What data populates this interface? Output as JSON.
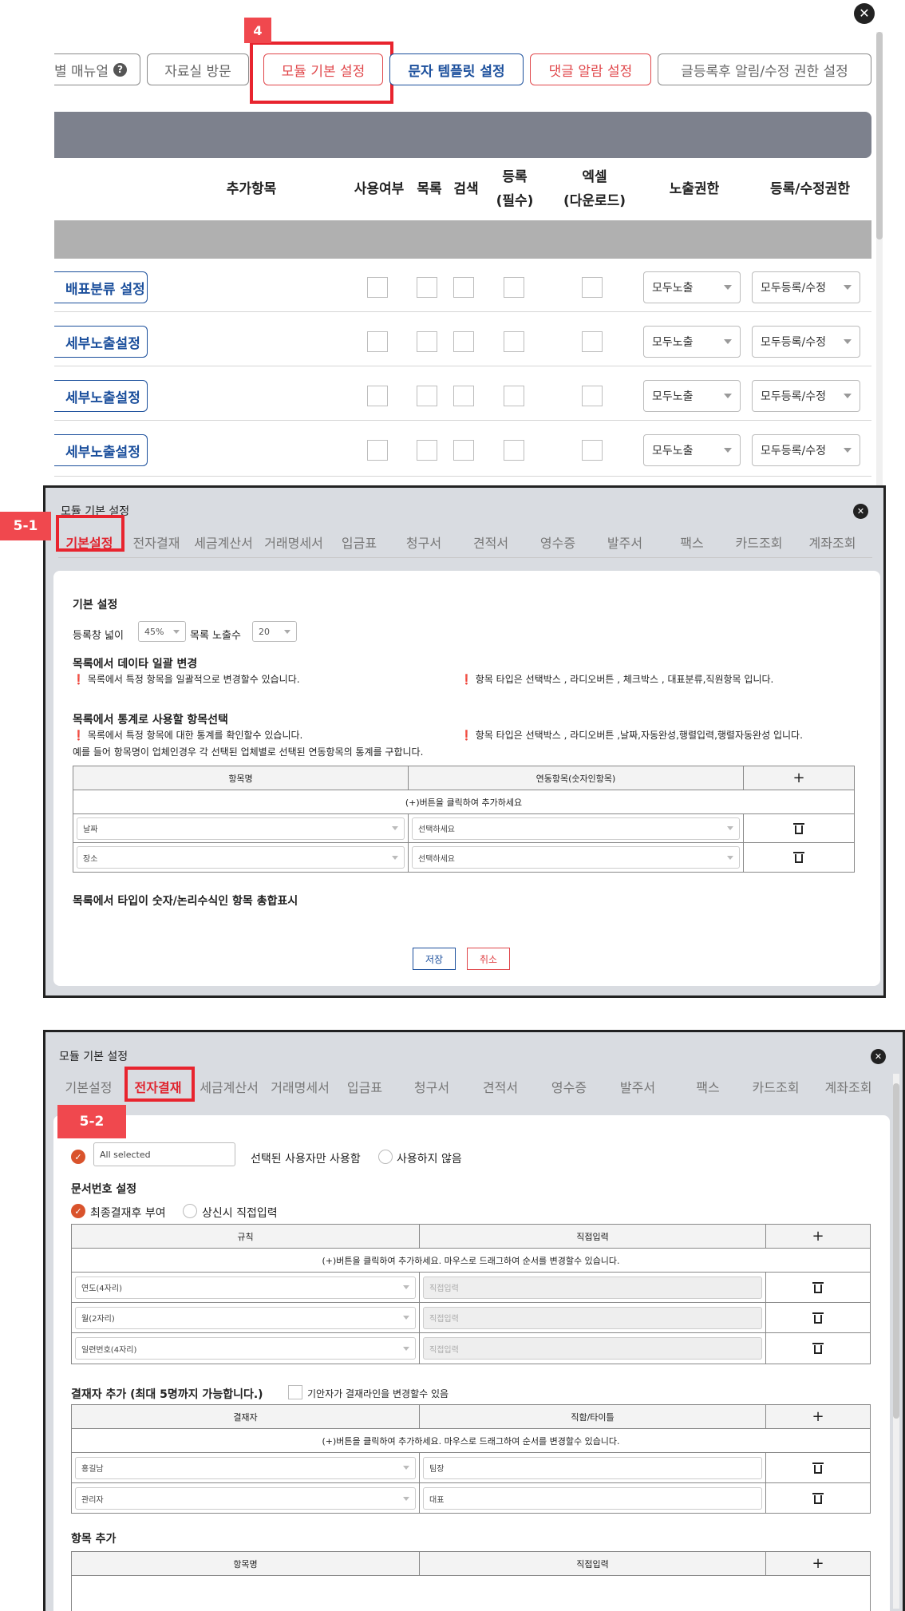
{
  "top": {
    "toolbar": [
      {
        "label": "별 매뉴얼",
        "style": "gray"
      },
      {
        "label": "자료실 방문",
        "style": "gray"
      },
      {
        "label": "모듈 기본 설정",
        "style": "red"
      },
      {
        "label": "문자 템플릿 설정",
        "style": "blue"
      },
      {
        "label": "댓글 알람 설정",
        "style": "red"
      },
      {
        "label": "글등록후 알림/수정 권한 설정",
        "style": "gray"
      }
    ],
    "badge": "4",
    "columns": {
      "extra_item": "추가항목",
      "use": "사용여부",
      "list": "목록",
      "search": "검색",
      "register_1": "등록",
      "register_2": "(필수)",
      "excel_1": "엑셀",
      "excel_2": "(다운로드)",
      "exposure": "노출권한",
      "edit": "등록/수정권한"
    },
    "rows": [
      {
        "label": "배표분류 설정",
        "exposure": "모두노출",
        "edit": "모두등록/수정"
      },
      {
        "label": "세부노출설정",
        "exposure": "모두노출",
        "edit": "모두등록/수정"
      },
      {
        "label": "세부노출설정",
        "exposure": "모두노출",
        "edit": "모두등록/수정"
      },
      {
        "label": "세부노출설정",
        "exposure": "모두노출",
        "edit": "모두등록/수정"
      }
    ]
  },
  "tabs": [
    "기본설정",
    "전자결재",
    "세금계산서",
    "거래명세서",
    "입금표",
    "청구서",
    "견적서",
    "영수증",
    "발주서",
    "팩스",
    "카드조회",
    "계좌조회"
  ],
  "modal1": {
    "title": "모듈 기본 설정",
    "badge": "5-1",
    "basic": {
      "heading": "기본 설정",
      "width_label": "등록창 넓이",
      "width_value": "45%",
      "count_label": "목록 노출수",
      "count_value": "20"
    },
    "bulk": {
      "heading": "목록에서 데이타 일괄 변경",
      "note_left": "목록에서 특정 항목을 일괄적으로 변경할수 있습니다.",
      "note_right": "항목 타입은 선택박스 , 라디오버튼 , 체크박스 , 대표분류,직원항목 입니다."
    },
    "stats": {
      "heading": "목록에서 통계로 사용할 항목선택",
      "note_left": "목록에서 특정 항목에 대한 통계를 확인할수 있습니다.",
      "note_right": "항목 타입은 선택박스 , 라디오버튼 ,날짜,자동완성,행렬입력,행렬자동완성 입니다.",
      "example": "예를 들어 항목명이 업체인경우 각 선택된 업체별로 선택된 연동항목의 통계를 구합니다.",
      "col_item": "항목명",
      "col_link": "연동항목(숫자인항목)",
      "hint": "(+)버튼을 클릭하여 추가하세요",
      "rows": [
        {
          "item": "날짜",
          "link": "선택하세요"
        },
        {
          "item": "장소",
          "link": "선택하세요"
        }
      ]
    },
    "summary_heading": "목록에서 타입이 숫자/논리수식인 항목 총합표시",
    "save": "저장",
    "cancel": "취소"
  },
  "modal2": {
    "title": "모듈 기본 설정",
    "badge": "5-2",
    "user_select": "All selected",
    "opt_selected_users": "선택된 사용자만 사용함",
    "opt_not_use": "사용하지 않음",
    "docnum": {
      "heading": "문서번호 설정",
      "opt_final": "최종결재후 부여",
      "opt_direct": "상신시 직접입력",
      "col_rule": "규칙",
      "col_input": "직접입력",
      "hint": "(+)버튼을 클릭하여 추가하세요. 마우스로 드래그하여 순서를 변경할수 있습니다.",
      "rows": [
        {
          "rule": "연도(4자리)",
          "input": "직접입력"
        },
        {
          "rule": "월(2자리)",
          "input": "직접입력"
        },
        {
          "rule": "일련번호(4자리)",
          "input": "직접입력"
        }
      ]
    },
    "approver": {
      "heading": "결재자 추가 (최대 5명까지 가능합니다.)",
      "check_label": "기안자가 결재라인을 변경할수 있음",
      "col_name": "결재자",
      "col_title": "직함/타이틀",
      "hint": "(+)버튼을 클릭하여 추가하세요. 마우스로 드래그하여 순서를 변경할수 있습니다.",
      "rows": [
        {
          "name": "홍길남",
          "title": "팀장"
        },
        {
          "name": "관리자",
          "title": "대표"
        }
      ]
    },
    "items": {
      "heading": "항목 추가",
      "col_name": "항목명",
      "col_input": "직접입력"
    }
  },
  "plus": "+",
  "close": "✕",
  "info": "❗"
}
